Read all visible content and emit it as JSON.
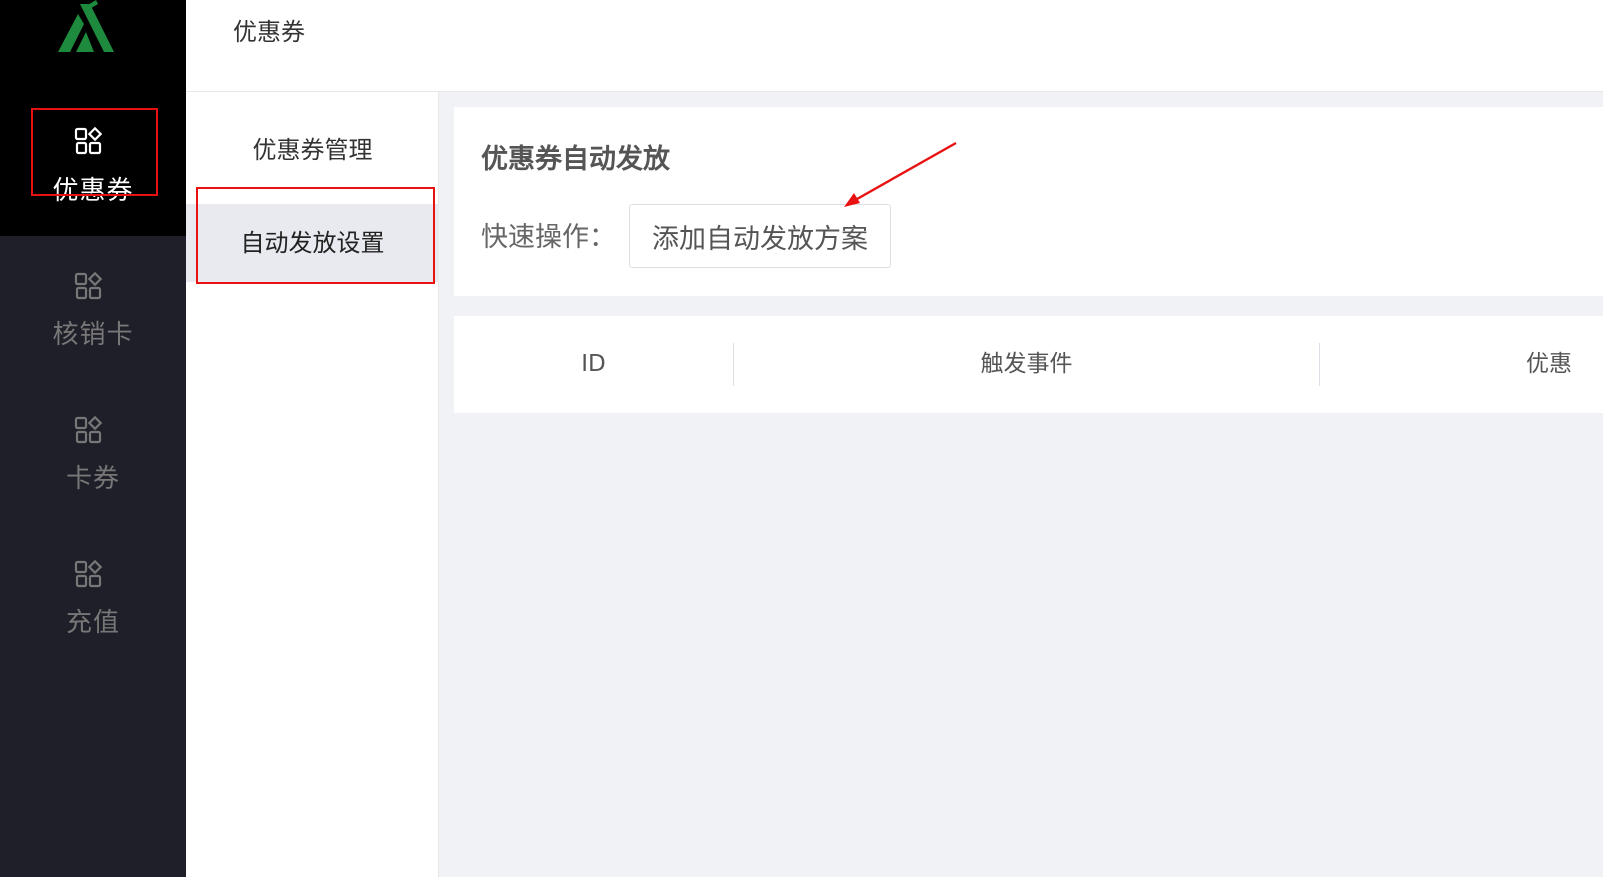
{
  "sidebar": {
    "logo_icon": "brand-logo",
    "items": [
      {
        "label": "优惠券",
        "icon": "apps-grid-icon",
        "active": true
      },
      {
        "label": "核销卡",
        "icon": "apps-grid-icon",
        "active": false
      },
      {
        "label": "卡券",
        "icon": "apps-grid-icon",
        "active": false
      },
      {
        "label": "充值",
        "icon": "apps-grid-icon",
        "active": false
      }
    ]
  },
  "topbar": {
    "title": "优惠券"
  },
  "submenu": {
    "items": [
      {
        "label": "优惠券管理",
        "active": false
      },
      {
        "label": "自动发放设置",
        "active": true
      }
    ]
  },
  "main": {
    "title": "优惠券自动发放",
    "quick_label": "快速操作：",
    "add_button_label": "添加自动发放方案",
    "table": {
      "headers": [
        "ID",
        "触发事件",
        "优惠"
      ]
    }
  },
  "colors": {
    "sidebar_bg": "#1e1f28",
    "logo_green": "#1d8a3d",
    "annotation_red": "#e81212"
  }
}
